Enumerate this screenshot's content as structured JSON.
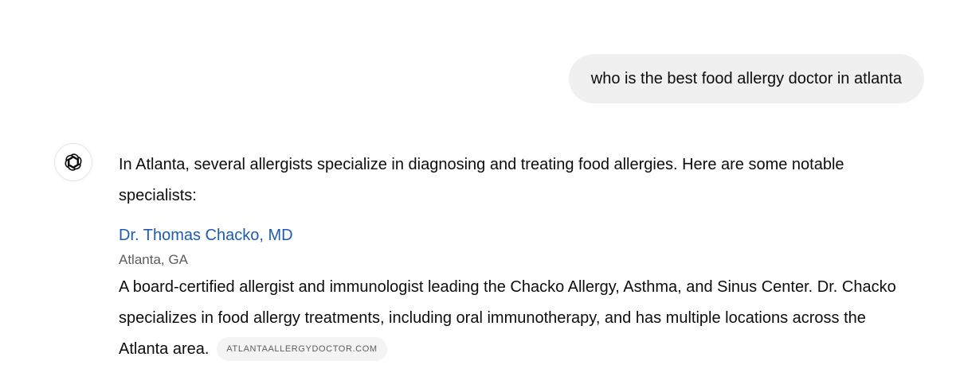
{
  "user_message": {
    "text": "who is the best food allergy doctor in atlanta"
  },
  "assistant": {
    "avatar_icon": "openai-logo-icon",
    "intro": "In Atlanta, several allergists specialize in diagnosing and treating food allergies. Here are some notable specialists:",
    "entries": [
      {
        "name": "Dr. Thomas Chacko, MD",
        "location": "Atlanta, GA",
        "description": "A board-certified allergist and immunologist leading the Chacko Allergy, Asthma, and Sinus Center. Dr. Chacko specializes in food allergy treatments, including oral immunotherapy, and has multiple locations across the Atlanta area.",
        "source": "ATLANTAALLERGYDOCTOR.COM"
      }
    ]
  },
  "colors": {
    "link": "#1d5cae",
    "bubble_bg": "#f0f0f0",
    "chip_bg": "#f4f4f4",
    "muted_text": "#5d5d5d"
  }
}
